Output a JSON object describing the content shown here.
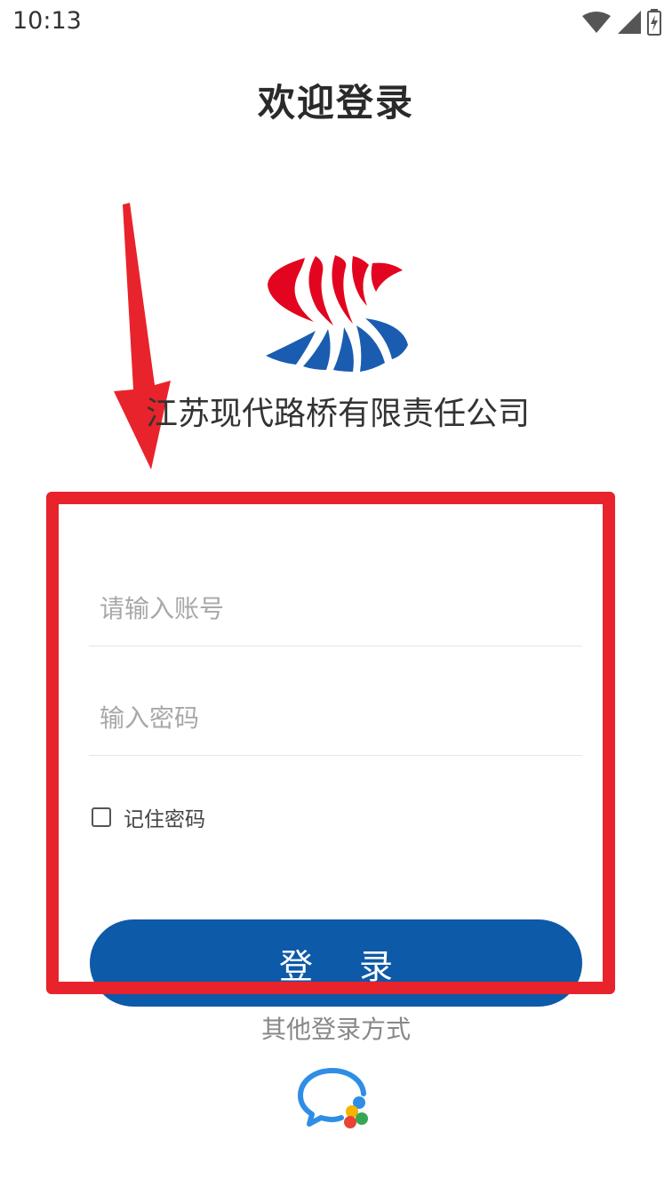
{
  "status_bar": {
    "time": "10:13",
    "icons": [
      "wifi-icon",
      "signal-icon",
      "battery-charging-icon"
    ]
  },
  "header": {
    "title": "欢迎登录"
  },
  "brand": {
    "company_name": "江苏现代路桥有限责任公司",
    "logo_colors": {
      "red": "#e3051f",
      "blue": "#1a5cb0"
    }
  },
  "form": {
    "account_placeholder": "请输入账号",
    "account_value": "",
    "password_placeholder": "输入密码",
    "password_value": "",
    "remember_label": "记住密码",
    "remember_checked": false,
    "login_label": "登 录"
  },
  "alt_login": {
    "label": "其他登录方式",
    "icon": "wework-icon"
  },
  "colors": {
    "primary": "#0d5aa8",
    "annotation": "#e8232b"
  }
}
